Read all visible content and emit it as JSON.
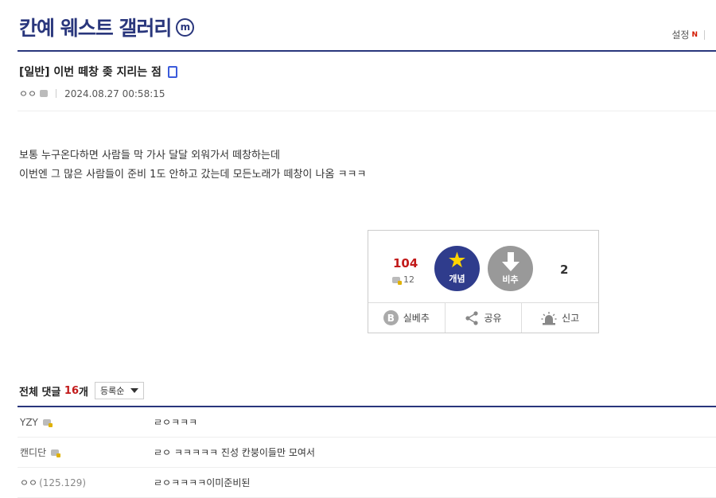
{
  "gallery": {
    "title": "칸예 웨스트 갤러리",
    "badge": "m"
  },
  "header": {
    "settings_label": "설정",
    "new_badge": "N"
  },
  "post": {
    "title": "[일반] 이번 떼창 좆 지리는 점",
    "author": "ㅇㅇ",
    "date": "2024.08.27 00:58:15",
    "lines": [
      "보통 누구온다하면 사람들 막 가사 달달 외워가서 떼창하는데",
      "이번엔 그 많은 사람들이 준비 1도 안하고 갔는데 모든노래가 떼창이 나옴 ㅋㅋㅋ"
    ]
  },
  "votes": {
    "up_count": "104",
    "fixed_count": "12",
    "recommend_label": "개념",
    "downvote_label": "비추",
    "down_count": "2",
    "actions": {
      "real_downvote": "실베추",
      "share": "공유",
      "report": "신고"
    }
  },
  "comments": {
    "label": "전체 댓글",
    "count": "16",
    "unit": "개",
    "sort_value": "등록순",
    "items": [
      {
        "writer": "YZY",
        "ip": "",
        "text": "ㄹㅇㅋㅋㅋ"
      },
      {
        "writer": "캔디단",
        "ip": "",
        "text": "ㄹㅇ ㅋㅋㅋㅋㅋ 진성 칸붕이들만 모여서"
      },
      {
        "writer": "ㅇㅇ",
        "ip": "(125.129)",
        "text": "ㄹㅇㅋㅋㅋㅋ이미준비된"
      }
    ]
  },
  "colors": {
    "brand": "#29367c",
    "accent_red": "#c21a1a",
    "star": "#ffd400"
  }
}
